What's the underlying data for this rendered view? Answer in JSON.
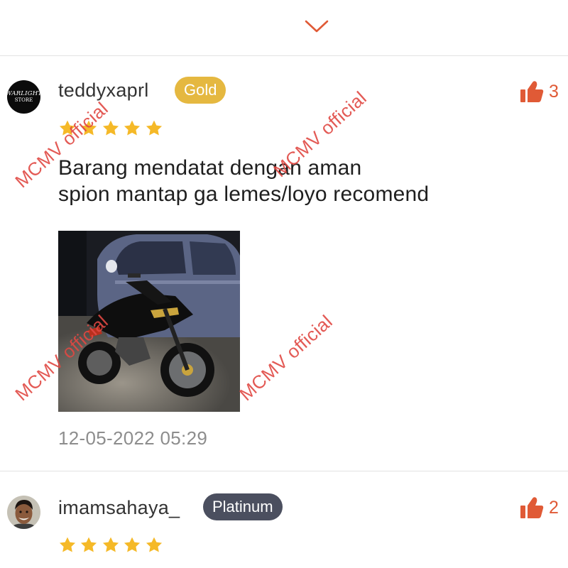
{
  "nav": {
    "collapse_icon": "chevron-down-icon"
  },
  "reviews": [
    {
      "avatar_text_line1": "WARLIGHT",
      "avatar_text_line2": "STORE",
      "username": "teddyxaprl",
      "tier": "Gold",
      "tier_color": "#e5b840",
      "likes": "3",
      "rating": 5,
      "text_lines": [
        "Barang mendatat dengan aman",
        "spion mantap ga lemes/loyo recomend"
      ],
      "timestamp": "12-05-2022 05:29"
    },
    {
      "username": "imamsahaya_",
      "tier": "Platinum",
      "tier_color": "#4b4f5f",
      "likes": "2",
      "rating": 5
    }
  ],
  "watermark": "MCMV official",
  "colors": {
    "accent": "#e05a36",
    "star": "#f5b928"
  }
}
